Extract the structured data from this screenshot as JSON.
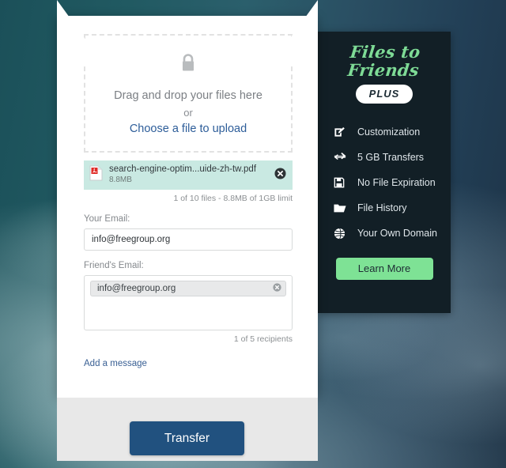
{
  "promo": {
    "logo": "Files to Friends",
    "badge": "PLUS",
    "features": [
      {
        "icon": "edit-square-icon",
        "label": "Customization"
      },
      {
        "icon": "transfer-arrows-icon",
        "label": "5 GB Transfers"
      },
      {
        "icon": "floppy-disk-icon",
        "label": "No File Expiration"
      },
      {
        "icon": "folder-icon",
        "label": "File History"
      },
      {
        "icon": "globe-icon",
        "label": "Your Own Domain"
      }
    ],
    "cta_label": "Learn More",
    "colors": {
      "panel_bg": "#121f26",
      "logo_green": "#7edb96",
      "cta_green": "#7ee295"
    }
  },
  "dropzone": {
    "icon": "lock-icon",
    "primary_text": "Drag and drop your files here",
    "separator_text": "or",
    "link_text": "Choose a file to upload"
  },
  "file": {
    "icon": "pdf-file-icon",
    "name": "search-engine-optim...uide-zh-tw.pdf",
    "size": "8.8MB",
    "remove_icon": "close-circle-icon",
    "chip_color": "#c9e9e2"
  },
  "files_count_text": "1 of 10 files - 8.8MB of 1GB limit",
  "form": {
    "your_email_label": "Your Email:",
    "your_email_value": "info@freegroup.org",
    "your_email_placeholder": "Your Email",
    "friends_email_label": "Friend's Email:",
    "recipient_chip": "info@freegroup.org",
    "recipient_remove_icon": "close-circle-icon",
    "recipients_count_text": "1 of 5 recipients",
    "add_message_label": "Add a message"
  },
  "footer": {
    "transfer_label": "Transfer",
    "transfer_color": "#21517f"
  }
}
